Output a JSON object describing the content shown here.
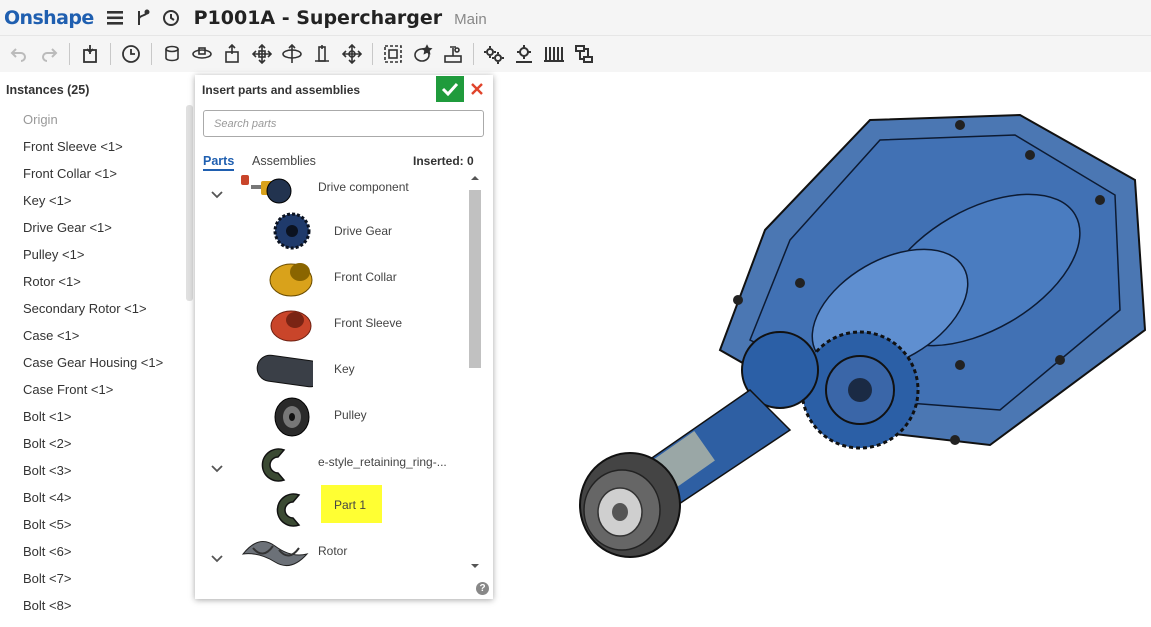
{
  "app": {
    "logo": "Onshape",
    "document_title": "P1001A - Supercharger",
    "branch": "Main"
  },
  "instances": {
    "header": "Instances (25)",
    "items": [
      {
        "label": "Origin",
        "muted": true
      },
      {
        "label": "Front Sleeve <1>"
      },
      {
        "label": "Front Collar <1>"
      },
      {
        "label": "Key <1>"
      },
      {
        "label": "Drive Gear <1>"
      },
      {
        "label": "Pulley <1>"
      },
      {
        "label": "Rotor <1>"
      },
      {
        "label": "Secondary Rotor <1>"
      },
      {
        "label": "Case <1>"
      },
      {
        "label": "Case Gear Housing <1>"
      },
      {
        "label": "Case Front <1>"
      },
      {
        "label": "Bolt <1>"
      },
      {
        "label": "Bolt <2>"
      },
      {
        "label": "Bolt <3>"
      },
      {
        "label": "Bolt <4>"
      },
      {
        "label": "Bolt <5>"
      },
      {
        "label": "Bolt <6>"
      },
      {
        "label": "Bolt <7>"
      },
      {
        "label": "Bolt <8>"
      }
    ]
  },
  "insert_dialog": {
    "title": "Insert parts and assemblies",
    "search_placeholder": "Search parts",
    "tabs": {
      "parts": "Parts",
      "assemblies": "Assemblies"
    },
    "inserted": "Inserted: 0",
    "rows": [
      {
        "label": "Drive component",
        "group": true,
        "icon": "drive-component-thumb"
      },
      {
        "label": "Drive Gear",
        "icon": "gear-thumb"
      },
      {
        "label": "Front Collar",
        "icon": "collar-thumb"
      },
      {
        "label": "Front Sleeve",
        "icon": "sleeve-thumb"
      },
      {
        "label": "Key",
        "icon": "key-thumb"
      },
      {
        "label": "Pulley",
        "icon": "pulley-thumb"
      },
      {
        "label": "e-style_retaining_ring-...",
        "group": true,
        "icon": "retaining-ring-thumb"
      },
      {
        "label": "Part 1",
        "icon": "retaining-ring-thumb",
        "highlighted": true
      },
      {
        "label": "Rotor",
        "group": true,
        "icon": "rotor-thumb"
      }
    ]
  },
  "colors": {
    "brand": "#1f5fb0",
    "confirm": "#1f9b3c",
    "cancel": "#e0442b",
    "highlight": "#ffff33",
    "model_blue": "#2b5fa6"
  }
}
